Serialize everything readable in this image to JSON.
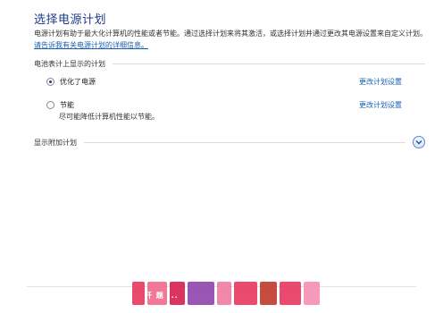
{
  "header": {
    "title": "选择电源计划",
    "description": "电源计划有助于最大化计算机的性能或者节能。通过选择计划来将其激活，或选择计划并通过更改其电源设置来自定义计划。",
    "details_link": "请告诉我有关电源计划的详细信息。"
  },
  "battery_section": {
    "heading": "电池表计上显示的计划"
  },
  "plans": [
    {
      "name": "优化了电源",
      "selected": true,
      "description": "",
      "change_link": "更改计划设置"
    },
    {
      "name": "节能",
      "selected": false,
      "description": "尽可能降低计算机性能以节能。",
      "change_link": "更改计划设置"
    }
  ],
  "additional_plans": {
    "label": "显示附加计划",
    "icon": "chevron-down-icon"
  },
  "watermark": {
    "text": "开 题 ...",
    "colors": [
      "#e8365d",
      "#f06a8a",
      "#d61f4f",
      "#8e44ad",
      "#f07aa0",
      "#e8365d",
      "#c0392b",
      "#e8365d",
      "#f48fb1"
    ]
  },
  "colors": {
    "title": "#1e3a8a",
    "link": "#1a5fb4"
  }
}
